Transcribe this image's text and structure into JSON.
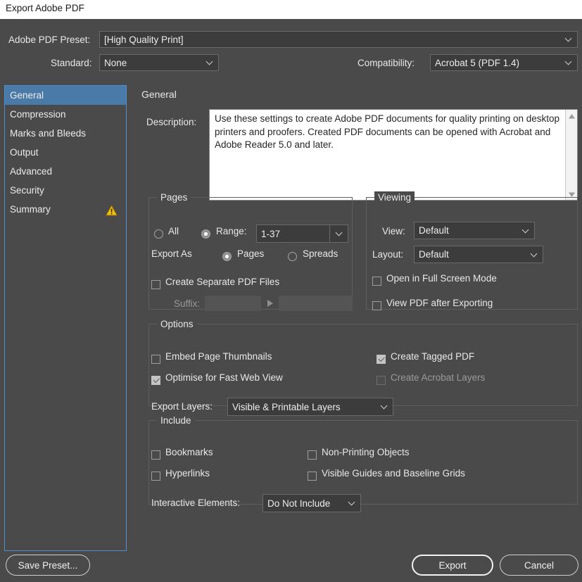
{
  "window": {
    "title": "Export Adobe PDF"
  },
  "colors": {
    "dialog_bg": "#4a4a4a",
    "titlebar_bg": "#ffffff",
    "selection_blue": "#4a7aa8",
    "focus_border": "#4f8fd0",
    "field_bg": "#3c3c3c",
    "warning_yellow": "#f2c218",
    "text": "#e8e8e8",
    "text_disabled": "#9a9a9a"
  },
  "top": {
    "preset_label": "Adobe PDF Preset:",
    "preset_value": "[High Quality Print]",
    "standard_label": "Standard:",
    "standard_value": "None",
    "compatibility_label": "Compatibility:",
    "compatibility_value": "Acrobat 5 (PDF 1.4)"
  },
  "sidebar": {
    "items": [
      {
        "label": "General",
        "selected": true,
        "warning": false
      },
      {
        "label": "Compression",
        "selected": false,
        "warning": false
      },
      {
        "label": "Marks and Bleeds",
        "selected": false,
        "warning": false
      },
      {
        "label": "Output",
        "selected": false,
        "warning": false
      },
      {
        "label": "Advanced",
        "selected": false,
        "warning": false
      },
      {
        "label": "Security",
        "selected": false,
        "warning": false
      },
      {
        "label": "Summary",
        "selected": false,
        "warning": true
      }
    ]
  },
  "main": {
    "section_title": "General",
    "description_label": "Description:",
    "description_value": "Use these settings to create Adobe PDF documents for quality printing on desktop printers and proofers.  Created PDF documents can be opened with Acrobat and Adobe Reader 5.0 and later."
  },
  "pages": {
    "title": "Pages",
    "all_label": "All",
    "all_selected": false,
    "range_label": "Range:",
    "range_selected": true,
    "range_value": "1-37",
    "export_as_label": "Export As",
    "pages_label": "Pages",
    "pages_selected": true,
    "spreads_label": "Spreads",
    "spreads_selected": false,
    "separate_files_label": "Create Separate PDF Files",
    "separate_files_checked": false,
    "suffix_label": "Suffix:",
    "suffix_value": "",
    "suffix_second_value": "",
    "suffix_disabled": true
  },
  "viewing": {
    "title": "Viewing",
    "view_label": "View:",
    "view_value": "Default",
    "layout_label": "Layout:",
    "layout_value": "Default",
    "fullscreen_label": "Open in Full Screen Mode",
    "fullscreen_checked": false,
    "viewpdf_label": "View PDF after Exporting",
    "viewpdf_checked": false
  },
  "options": {
    "title": "Options",
    "embed_thumbnails_label": "Embed Page Thumbnails",
    "embed_thumbnails_checked": false,
    "tagged_pdf_label": "Create Tagged PDF",
    "tagged_pdf_checked": true,
    "fast_web_label": "Optimise for Fast Web View",
    "fast_web_checked": true,
    "acrobat_layers_label": "Create Acrobat Layers",
    "acrobat_layers_checked": false,
    "acrobat_layers_disabled": true,
    "export_layers_label": "Export Layers:",
    "export_layers_value": "Visible & Printable Layers"
  },
  "include": {
    "title": "Include",
    "bookmarks_label": "Bookmarks",
    "bookmarks_checked": false,
    "hyperlinks_label": "Hyperlinks",
    "hyperlinks_checked": false,
    "nonprinting_label": "Non-Printing Objects",
    "nonprinting_checked": false,
    "guides_label": "Visible Guides and Baseline Grids",
    "guides_checked": false,
    "interactive_label": "Interactive Elements:",
    "interactive_value": "Do Not Include"
  },
  "footer": {
    "save_preset_label": "Save Preset...",
    "export_label": "Export",
    "cancel_label": "Cancel"
  }
}
